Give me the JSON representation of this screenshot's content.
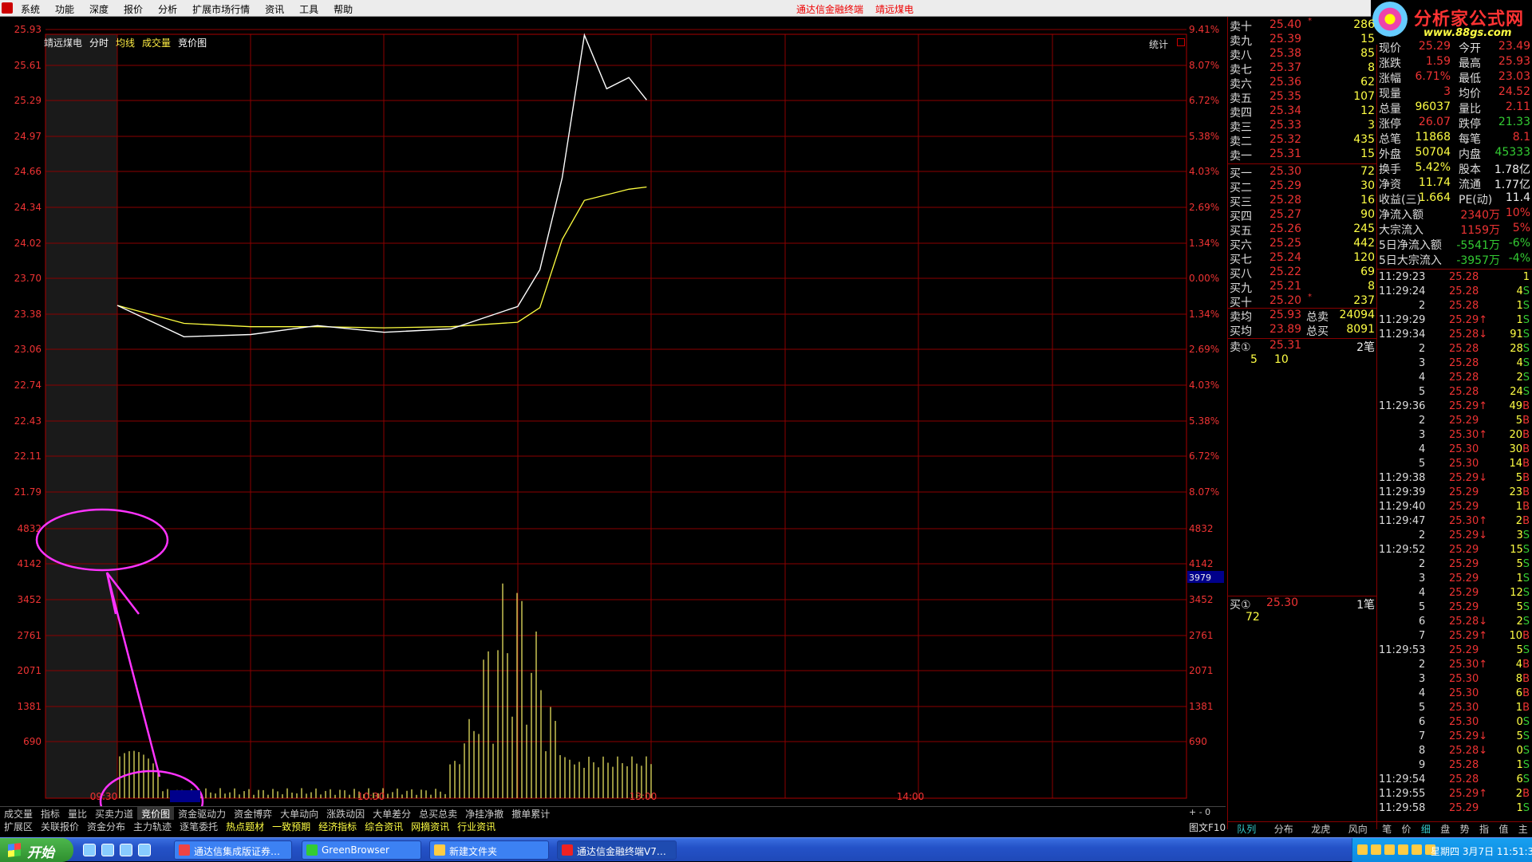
{
  "menu": {
    "items": [
      "系统",
      "功能",
      "深度",
      "报价",
      "分析",
      "扩展市场行情",
      "资讯",
      "工具",
      "帮助"
    ],
    "title": "通达信金融终端",
    "stock": "靖远煤电"
  },
  "brand": {
    "name": "分析家公式网",
    "url": "www.88gs.com"
  },
  "chart": {
    "header": {
      "stock": "靖远煤电",
      "tab1": "分时",
      "tab2": "均线",
      "tab3": "成交量",
      "tab4": "竞价图"
    },
    "stats_label": "统计",
    "price_axis": [
      "25.93",
      "25.61",
      "25.29",
      "24.97",
      "24.66",
      "24.34",
      "24.02",
      "23.70",
      "23.38",
      "23.06",
      "22.74",
      "22.43",
      "22.11",
      "21.79"
    ],
    "pct_axis": [
      "9.41%",
      "8.07%",
      "6.72%",
      "5.38%",
      "4.03%",
      "2.69%",
      "1.34%",
      "0.00%",
      "1.34%",
      "2.69%",
      "4.03%",
      "5.38%",
      "6.72%",
      "8.07%"
    ],
    "vol_axis": [
      "4832",
      "4142",
      "3452",
      "2761",
      "2071",
      "1381",
      "690"
    ],
    "vol_cursor": "3979",
    "time_labels": [
      "09:30",
      "09:47",
      "10:30",
      "13:00",
      "14:00"
    ],
    "layout_label": "布局",
    "zoom_label": "+ - 0",
    "f10_label": "图文F10",
    "colors": {
      "price_line": "#ffffff",
      "avg_line": "#ffff40",
      "grid": "#8b0000",
      "annotation": "#ff33ff"
    }
  },
  "chart_data": {
    "type": "line",
    "title": "靖远煤电",
    "xlabel": "",
    "ylabel": "",
    "ylim": [
      21.79,
      25.93
    ],
    "preclose": 23.7,
    "x": [
      "09:30",
      "09:45",
      "10:00",
      "10:15",
      "10:30",
      "10:45",
      "11:00",
      "11:05",
      "11:10",
      "11:15",
      "11:20",
      "11:25",
      "11:29"
    ],
    "series": [
      {
        "name": "价格",
        "values": [
          23.46,
          23.18,
          23.2,
          23.28,
          23.22,
          23.25,
          23.45,
          23.78,
          24.6,
          25.88,
          25.4,
          25.5,
          25.3
        ]
      },
      {
        "name": "均价",
        "values": [
          23.46,
          23.3,
          23.27,
          23.27,
          23.26,
          23.27,
          23.31,
          23.44,
          24.05,
          24.4,
          24.45,
          24.5,
          24.52
        ]
      }
    ],
    "volume": {
      "ylim": [
        0,
        4832
      ],
      "peak": 4142,
      "cursor": 3979
    }
  },
  "bottom_tabs_1": [
    "成交量",
    "指标",
    "量比",
    "买卖力道",
    "竞价图",
    "资金驱动力",
    "资金博弈",
    "大单动向",
    "涨跌动因",
    "大单差分",
    "总买总卖",
    "净挂净撤",
    "撤单累计"
  ],
  "bottom_tabs_2": [
    "扩展区",
    "关联报价",
    "资金分布",
    "主力轨迹",
    "逐笔委托",
    "热点题材",
    "一致预期",
    "经济指标",
    "综合资讯",
    "网摘资讯",
    "行业资讯"
  ],
  "orderbook": {
    "sell": [
      {
        "label": "卖十",
        "price": "25.40",
        "vol": "286",
        "mark": "*"
      },
      {
        "label": "卖九",
        "price": "25.39",
        "vol": "15",
        "mark": ""
      },
      {
        "label": "卖八",
        "price": "25.38",
        "vol": "85",
        "mark": ""
      },
      {
        "label": "卖七",
        "price": "25.37",
        "vol": "8",
        "mark": ""
      },
      {
        "label": "卖六",
        "price": "25.36",
        "vol": "62",
        "mark": ""
      },
      {
        "label": "卖五",
        "price": "25.35",
        "vol": "107",
        "mark": ""
      },
      {
        "label": "卖四",
        "price": "25.34",
        "vol": "12",
        "mark": ""
      },
      {
        "label": "卖三",
        "price": "25.33",
        "vol": "3",
        "mark": ""
      },
      {
        "label": "卖二",
        "price": "25.32",
        "vol": "435",
        "mark": ""
      },
      {
        "label": "卖一",
        "price": "25.31",
        "vol": "15",
        "mark": ""
      }
    ],
    "buy": [
      {
        "label": "买一",
        "price": "25.30",
        "vol": "72",
        "mark": ""
      },
      {
        "label": "买二",
        "price": "25.29",
        "vol": "30",
        "mark": ""
      },
      {
        "label": "买三",
        "price": "25.28",
        "vol": "16",
        "mark": ""
      },
      {
        "label": "买四",
        "price": "25.27",
        "vol": "90",
        "mark": ""
      },
      {
        "label": "买五",
        "price": "25.26",
        "vol": "245",
        "mark": ""
      },
      {
        "label": "买六",
        "price": "25.25",
        "vol": "442",
        "mark": ""
      },
      {
        "label": "买七",
        "price": "25.24",
        "vol": "120",
        "mark": ""
      },
      {
        "label": "买八",
        "price": "25.22",
        "vol": "69",
        "mark": ""
      },
      {
        "label": "买九",
        "price": "25.21",
        "vol": "8",
        "mark": ""
      },
      {
        "label": "买十",
        "price": "25.20",
        "vol": "237",
        "mark": "*"
      }
    ],
    "avg_sell": {
      "label": "卖均",
      "price": "25.93",
      "tlabel": "总卖",
      "tval": "24094"
    },
    "avg_buy": {
      "label": "买均",
      "price": "23.89",
      "tlabel": "总买",
      "tval": "8091"
    },
    "sell1_detail": {
      "label": "卖①",
      "price": "25.31",
      "count": "2笔",
      "v1": "5",
      "v2": "10"
    },
    "buy1_detail": {
      "label": "买①",
      "price": "25.30",
      "count": "1笔",
      "v1": "72"
    },
    "tabs": [
      "队列",
      "分布",
      "龙虎",
      "风向"
    ]
  },
  "quote": {
    "rows": [
      [
        "现价",
        "25.29",
        "今开",
        "23.49"
      ],
      [
        "涨跌",
        "1.59",
        "最高",
        "25.93"
      ],
      [
        "涨幅",
        "6.71%",
        "最低",
        "23.03"
      ],
      [
        "现量",
        "3",
        "均价",
        "24.52"
      ],
      [
        "总量",
        "96037",
        "量比",
        "2.11"
      ],
      [
        "涨停",
        "26.07",
        "跌停",
        "21.33"
      ],
      [
        "总笔",
        "11868",
        "每笔",
        "8.1"
      ],
      [
        "外盘",
        "50704",
        "内盘",
        "45333"
      ],
      [
        "换手",
        "5.42%",
        "股本",
        "1.78亿"
      ],
      [
        "净资",
        "11.74",
        "流通",
        "1.77亿"
      ],
      [
        "收益(三)",
        "1.664",
        "PE(动)",
        "11.4"
      ]
    ],
    "flows": [
      [
        "净流入额",
        "2340万",
        "10%"
      ],
      [
        "大宗流入",
        "1159万",
        "5%"
      ],
      [
        "5日净流入额",
        "-5541万",
        "-6%"
      ],
      [
        "5日大宗流入",
        "-3957万",
        "-4%"
      ]
    ],
    "tabs": [
      "笔",
      "价",
      "细",
      "盘",
      "势",
      "指",
      "值",
      "主"
    ]
  },
  "ticks": [
    [
      "11:29:23",
      "25.28",
      "1",
      ""
    ],
    [
      "11:29:24",
      "25.28",
      "4",
      "S"
    ],
    [
      "2",
      "25.28",
      "1",
      "S"
    ],
    [
      "11:29:29",
      "25.29↑",
      "1",
      "S"
    ],
    [
      "11:29:34",
      "25.28↓",
      "91",
      "S"
    ],
    [
      "2",
      "25.28",
      "28",
      "S"
    ],
    [
      "3",
      "25.28",
      "4",
      "S"
    ],
    [
      "4",
      "25.28",
      "2",
      "S"
    ],
    [
      "5",
      "25.28",
      "24",
      "S"
    ],
    [
      "11:29:36",
      "25.29↑",
      "49",
      "B"
    ],
    [
      "2",
      "25.29",
      "5",
      "B"
    ],
    [
      "3",
      "25.30↑",
      "20",
      "B"
    ],
    [
      "4",
      "25.30",
      "30",
      "B"
    ],
    [
      "5",
      "25.30",
      "14",
      "B"
    ],
    [
      "11:29:38",
      "25.29↓",
      "5",
      "B"
    ],
    [
      "11:29:39",
      "25.29",
      "23",
      "B"
    ],
    [
      "11:29:40",
      "25.29",
      "1",
      "B"
    ],
    [
      "11:29:47",
      "25.30↑",
      "2",
      "B"
    ],
    [
      "2",
      "25.29↓",
      "3",
      "S"
    ],
    [
      "11:29:52",
      "25.29",
      "15",
      "S"
    ],
    [
      "2",
      "25.29",
      "5",
      "S"
    ],
    [
      "3",
      "25.29",
      "1",
      "S"
    ],
    [
      "4",
      "25.29",
      "12",
      "S"
    ],
    [
      "5",
      "25.29",
      "5",
      "S"
    ],
    [
      "6",
      "25.28↓",
      "2",
      "S"
    ],
    [
      "7",
      "25.29↑",
      "10",
      "B"
    ],
    [
      "11:29:53",
      "25.29",
      "5",
      "S"
    ],
    [
      "2",
      "25.30↑",
      "4",
      "B"
    ],
    [
      "3",
      "25.30",
      "8",
      "B"
    ],
    [
      "4",
      "25.30",
      "6",
      "B"
    ],
    [
      "5",
      "25.30",
      "1",
      "B"
    ],
    [
      "6",
      "25.30",
      "0",
      "S"
    ],
    [
      "7",
      "25.29↓",
      "5",
      "S"
    ],
    [
      "8",
      "25.28↓",
      "0",
      "S"
    ],
    [
      "9",
      "25.28",
      "1",
      "S"
    ],
    [
      "11:29:54",
      "25.28",
      "6",
      "S"
    ],
    [
      "11:29:55",
      "25.29↑",
      "2",
      "B"
    ],
    [
      "11:29:58",
      "25.29",
      "1",
      "S"
    ]
  ],
  "taskbar": {
    "start": "开始",
    "tasks": [
      "通达信集成版证券…",
      "GreenBrowser",
      "新建文件夹",
      "通达信金融终端V7…"
    ],
    "clock": "星期四 3月7日 11:51:30"
  }
}
